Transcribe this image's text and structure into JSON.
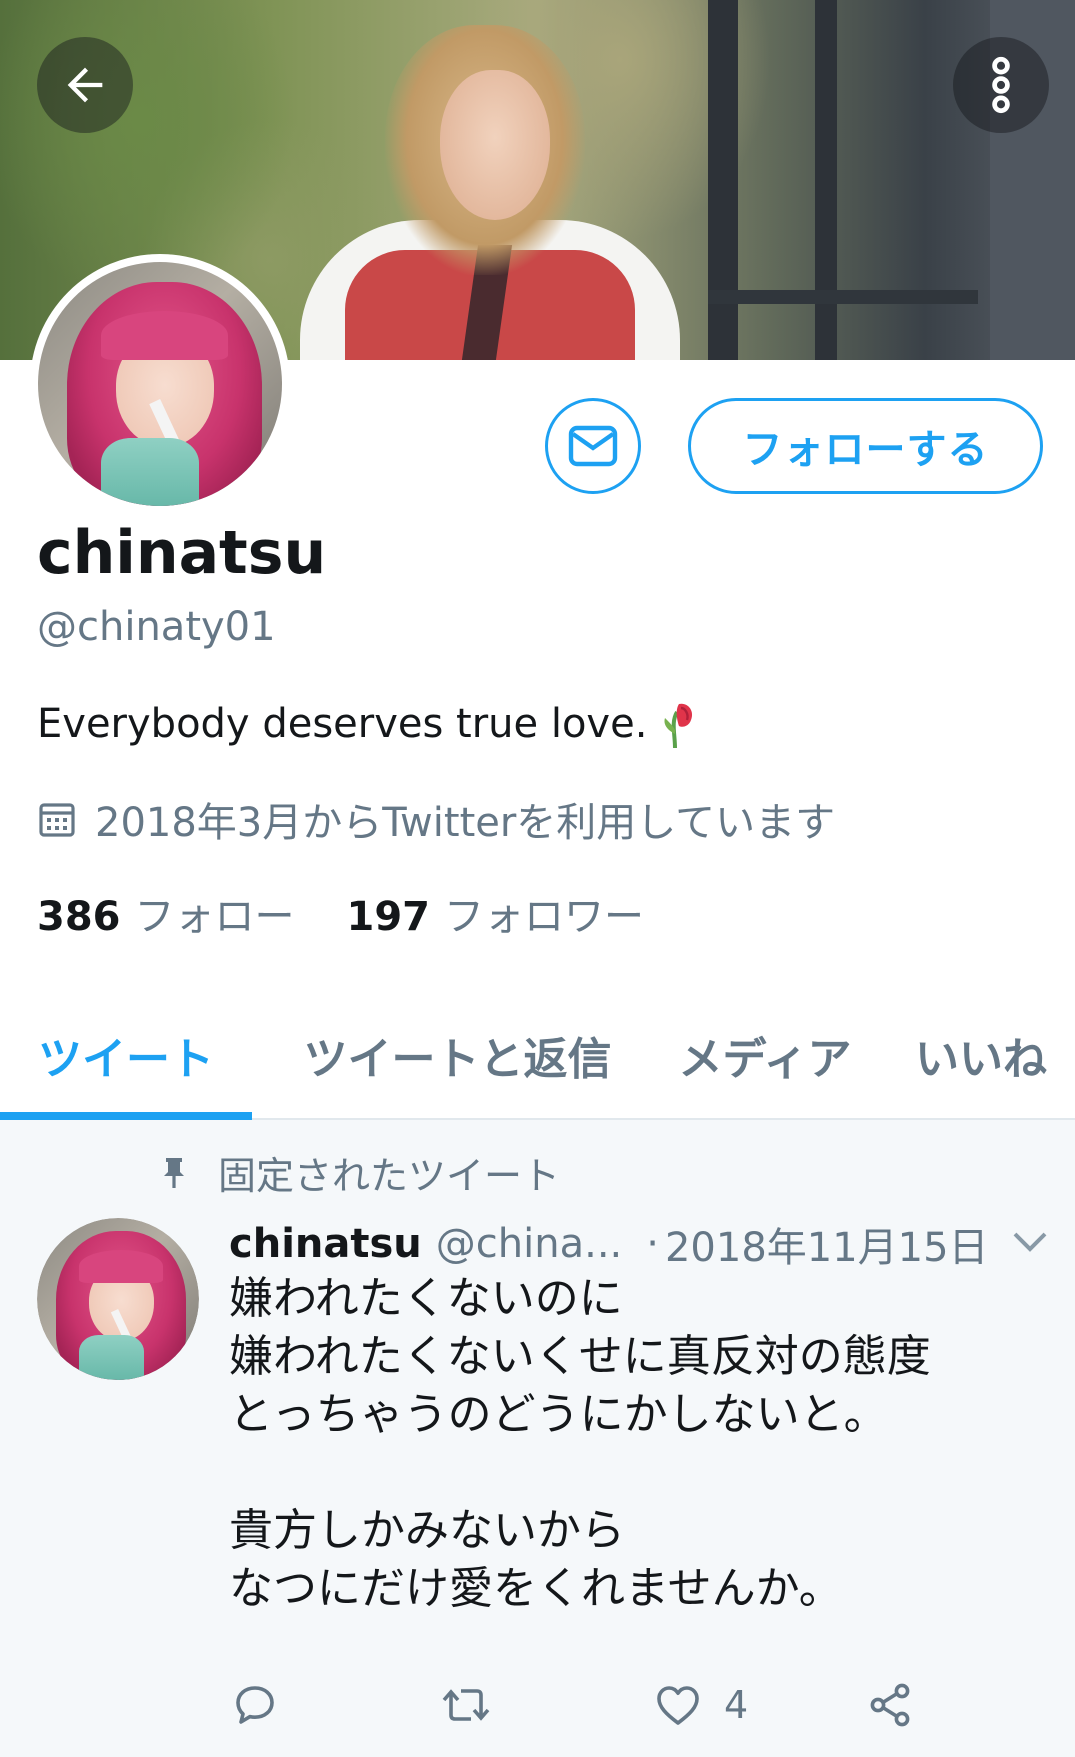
{
  "profile": {
    "name": "chinatsu",
    "handle": "@chinaty01",
    "bio": "Everybody deserves true love.",
    "bio_emoji_icon": "wilted-rose-icon",
    "joined": "2018年3月からTwitterを利用しています",
    "following_count": "386",
    "following_label": "フォロー",
    "followers_count": "197",
    "followers_label": "フォロワー"
  },
  "header": {
    "back_icon": "arrow-left-icon",
    "more_icon": "more-vertical-icon"
  },
  "actions": {
    "message_icon": "mail-icon",
    "follow_label": "フォローする"
  },
  "tabs": [
    {
      "label": "ツイート",
      "active": true
    },
    {
      "label": "ツイートと返信",
      "active": false
    },
    {
      "label": "メディア",
      "active": false
    },
    {
      "label": "いいね",
      "active": false
    }
  ],
  "pinned_tweet": {
    "pinned_label": "固定されたツイート",
    "author_name": "chinatsu",
    "author_handle": "@china...",
    "separator": "·",
    "date": "2018年11月15日",
    "lines": [
      "嫌われたくないのに",
      "嫌われたくないくせに真反対の態度",
      "とっちゃうのどうにかしないと。",
      "",
      "貴方しかみないから",
      "なつにだけ愛をくれませんか。"
    ],
    "like_count": "4"
  },
  "colors": {
    "accent": "#1da1f2",
    "text_primary": "#14171a",
    "text_secondary": "#657786",
    "tweet_background": "#f5f8fa"
  }
}
